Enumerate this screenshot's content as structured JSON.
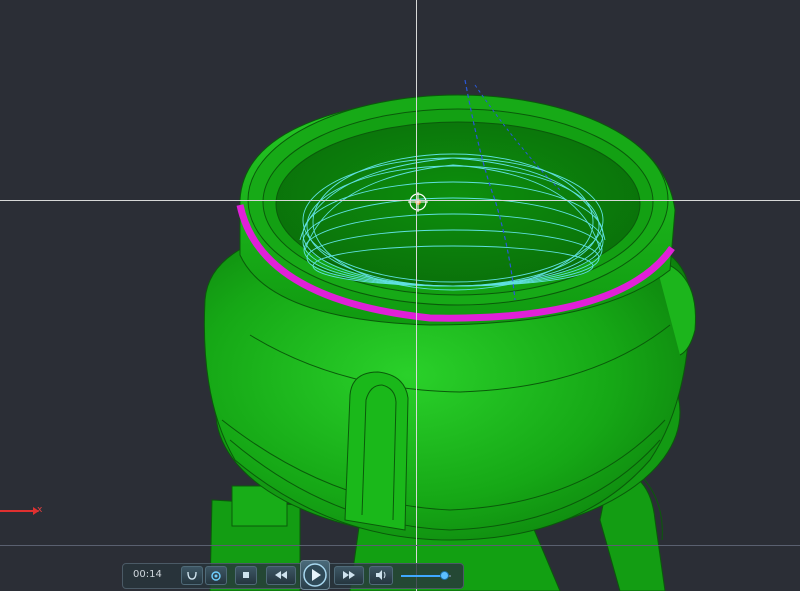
{
  "viewport": {
    "background": "#2b2e36",
    "model_color": "#1bb31b",
    "highlight_color": "#e020d8",
    "toolpath_color": "#5fe0e0"
  },
  "axis": {
    "x_label": "x"
  },
  "player": {
    "time": "00:14",
    "icons": [
      "path-icon",
      "loop-icon",
      "stop-icon",
      "rewind-icon",
      "play-icon",
      "fast-forward-icon",
      "volume-icon"
    ],
    "volume": 0.85
  }
}
